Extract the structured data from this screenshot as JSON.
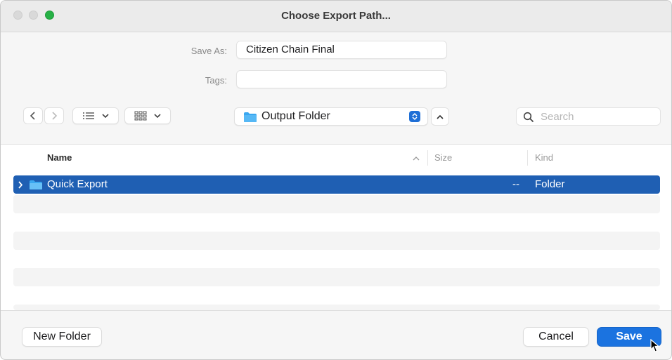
{
  "window": {
    "title": "Choose Export Path..."
  },
  "form": {
    "save_as_label": "Save As:",
    "save_as_value": "Citizen Chain Final",
    "tags_label": "Tags:",
    "tags_value": ""
  },
  "toolbar": {
    "back_icon": "chevron-left-icon",
    "forward_icon": "chevron-right-icon",
    "view_list_icon": "list-icon",
    "view_grid_icon": "grid-icon",
    "location_label": "Output Folder",
    "search_placeholder": "Search"
  },
  "list": {
    "columns": {
      "name": "Name",
      "size": "Size",
      "kind": "Kind"
    },
    "rows": [
      {
        "name": "Quick Export",
        "size": "--",
        "kind": "Folder",
        "selected": true
      }
    ]
  },
  "buttons": {
    "new_folder": "New Folder",
    "cancel": "Cancel",
    "save": "Save"
  },
  "colors": {
    "accent": "#1b73e0",
    "selection": "#1f5fb3",
    "folder": "#3aa7f0"
  }
}
